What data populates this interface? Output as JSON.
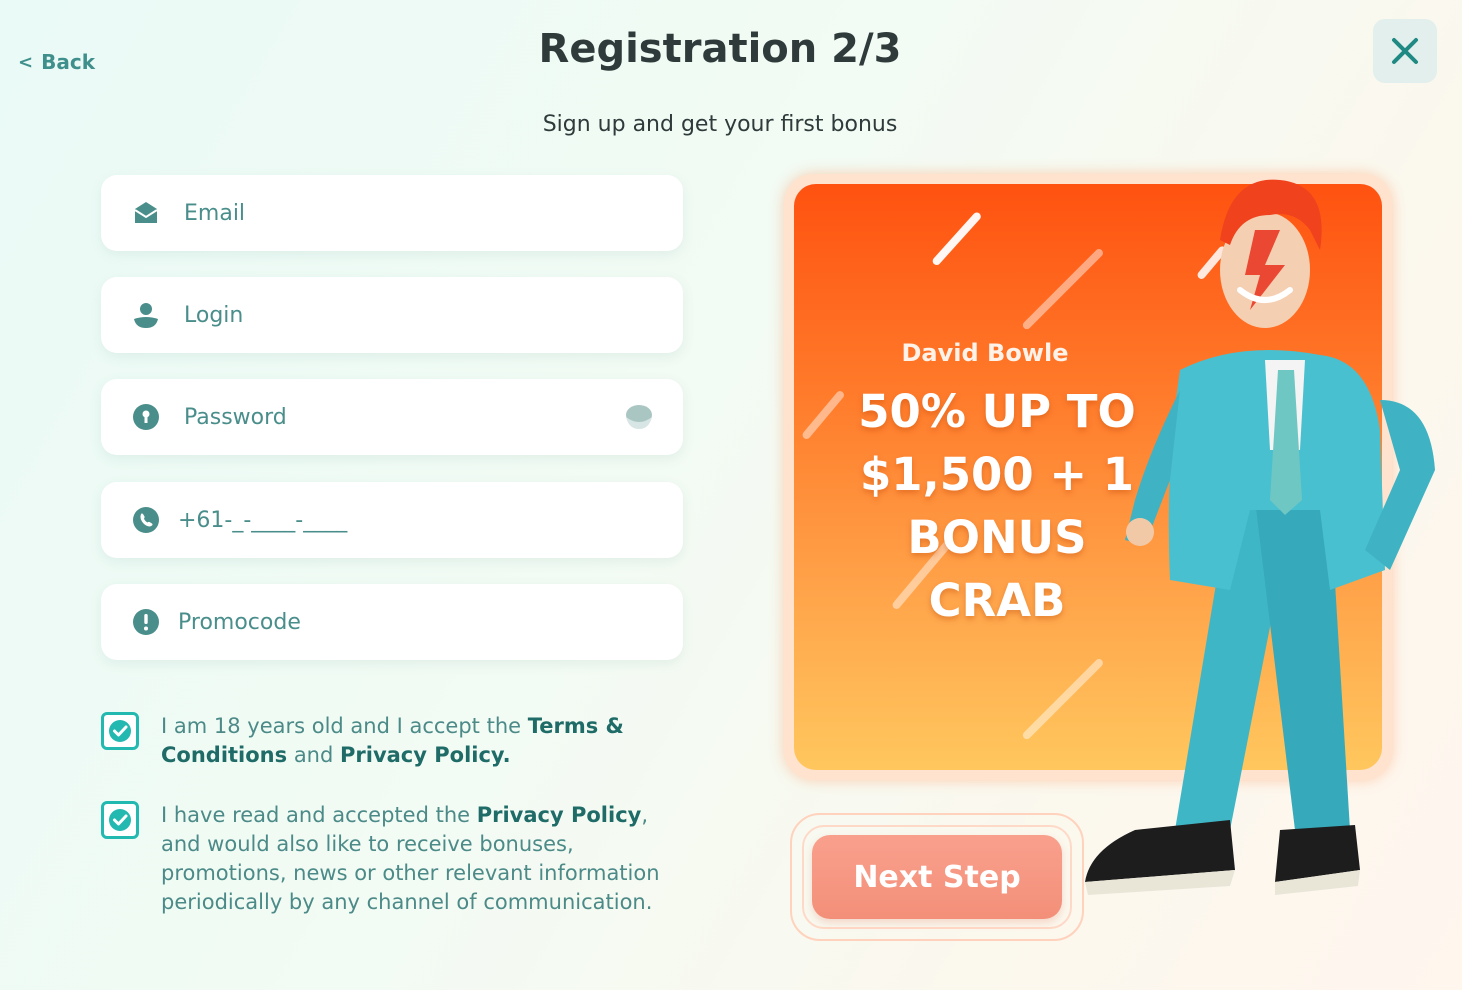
{
  "header": {
    "back_label": "Back",
    "title": "Registration 2/3",
    "subtitle": "Sign up and get your first bonus"
  },
  "form": {
    "email_placeholder": "Email",
    "login_placeholder": "Login",
    "password_placeholder": "Password",
    "phone_mask": "+61-_-____-____",
    "promocode_placeholder": "Promocode"
  },
  "consents": {
    "age": {
      "checked": true,
      "text_1": "I am 18 years old and I accept the ",
      "link_terms": "Terms & Conditions",
      "text_2": " and ",
      "link_privacy": "Privacy Policy."
    },
    "marketing": {
      "checked": true,
      "text_1": "I have read and accepted the ",
      "link_privacy": "Privacy Policy",
      "text_2": ", and would also like to receive bonuses, promotions, news or other relevant information periodically by any channel of communication."
    }
  },
  "promo": {
    "character_name": "David Bowle",
    "offer_lines": [
      "50% UP TO",
      "$1,500 + 1",
      "BONUS",
      "CRAB"
    ]
  },
  "actions": {
    "next_label": "Next Step"
  },
  "colors": {
    "accent_teal": "#24b9b0",
    "link_dark_teal": "#1f6b67",
    "promo_orange": "#ff5210",
    "button_salmon": "#f9a08d"
  }
}
